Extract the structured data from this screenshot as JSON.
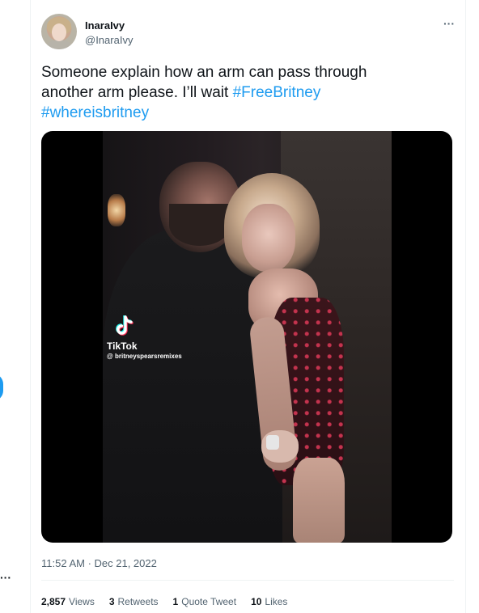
{
  "tweet": {
    "display_name": "InaraIvy",
    "handle": "@InaraIvy",
    "text_before": "Someone explain how an arm can pass through another arm please. I’ll wait ",
    "hashtags": [
      "#FreeBritney",
      "#whereisbritney"
    ],
    "timestamp": "11:52 AM · Dec 21, 2022",
    "media": {
      "watermark_brand": "TikTok",
      "watermark_user": "@ britneyspearsremixes"
    },
    "stats": [
      {
        "value": "2,857",
        "label": "Views"
      },
      {
        "value": "3",
        "label": "Retweets"
      },
      {
        "value": "1",
        "label": "Quote Tweet"
      },
      {
        "value": "10",
        "label": "Likes"
      }
    ]
  },
  "icons": {
    "more": "more-horizontal-icon",
    "tiktok": "tiktok-logo-icon"
  },
  "colors": {
    "accent": "#1d9bf0",
    "text": "#0f1419",
    "secondary": "#536471",
    "border": "#eff3f4"
  }
}
